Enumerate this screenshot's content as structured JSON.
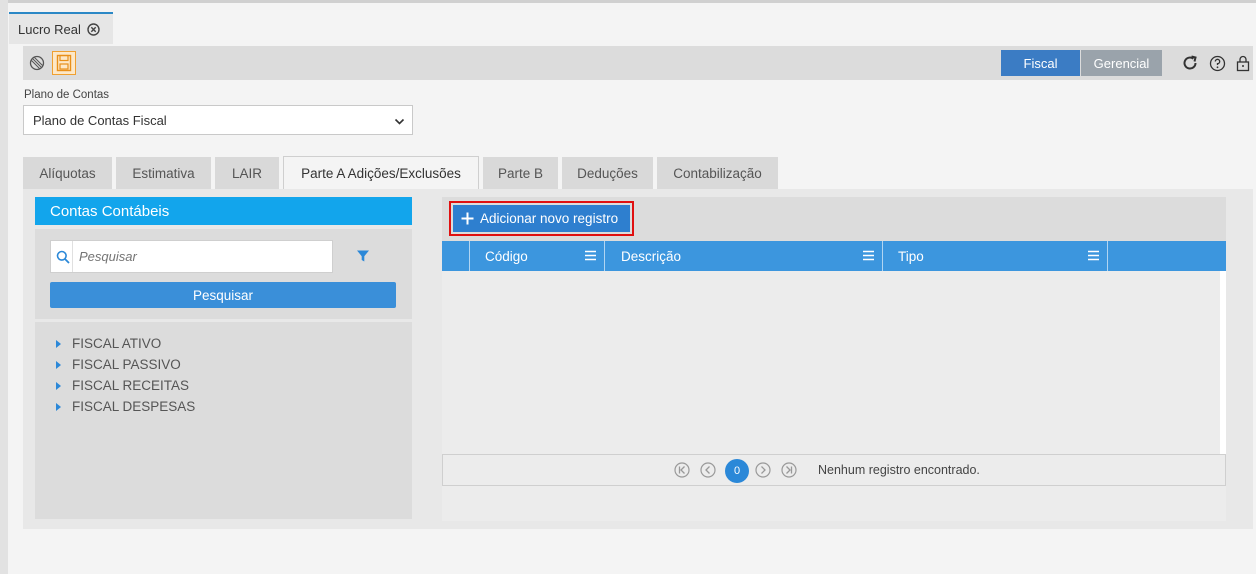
{
  "window_tab": {
    "title": "Lucro Real"
  },
  "toolbar": {
    "segments": [
      "Fiscal",
      "Gerencial"
    ],
    "icons": [
      "block-icon",
      "save-icon",
      "refresh-icon",
      "help-icon",
      "lock-icon"
    ]
  },
  "plano": {
    "label": "Plano de Contas",
    "selected": "Plano de Contas Fiscal"
  },
  "tabs": [
    {
      "label": "Alíquotas"
    },
    {
      "label": "Estimativa"
    },
    {
      "label": "LAIR"
    },
    {
      "label": "Parte A Adições/Exclusões",
      "active": true
    },
    {
      "label": "Parte B"
    },
    {
      "label": "Deduções"
    },
    {
      "label": "Contabilização"
    }
  ],
  "left_panel": {
    "title": "Contas Contábeis",
    "search_placeholder": "Pesquisar",
    "search_button": "Pesquisar",
    "tree": [
      "FISCAL ATIVO",
      "FISCAL PASSIVO",
      "FISCAL RECEITAS",
      "FISCAL DESPESAS"
    ]
  },
  "right_panel": {
    "add_button": "Adicionar novo registro",
    "columns": [
      "Código",
      "Descrição",
      "Tipo"
    ],
    "pager": {
      "current_page": "0",
      "status": "Nenhum registro encontrado."
    }
  },
  "colors": {
    "accent": "#2b88d8",
    "header_blue": "#12a5ec",
    "fiscal_active": "#3b7cc4",
    "highlight_border": "#e01010"
  }
}
